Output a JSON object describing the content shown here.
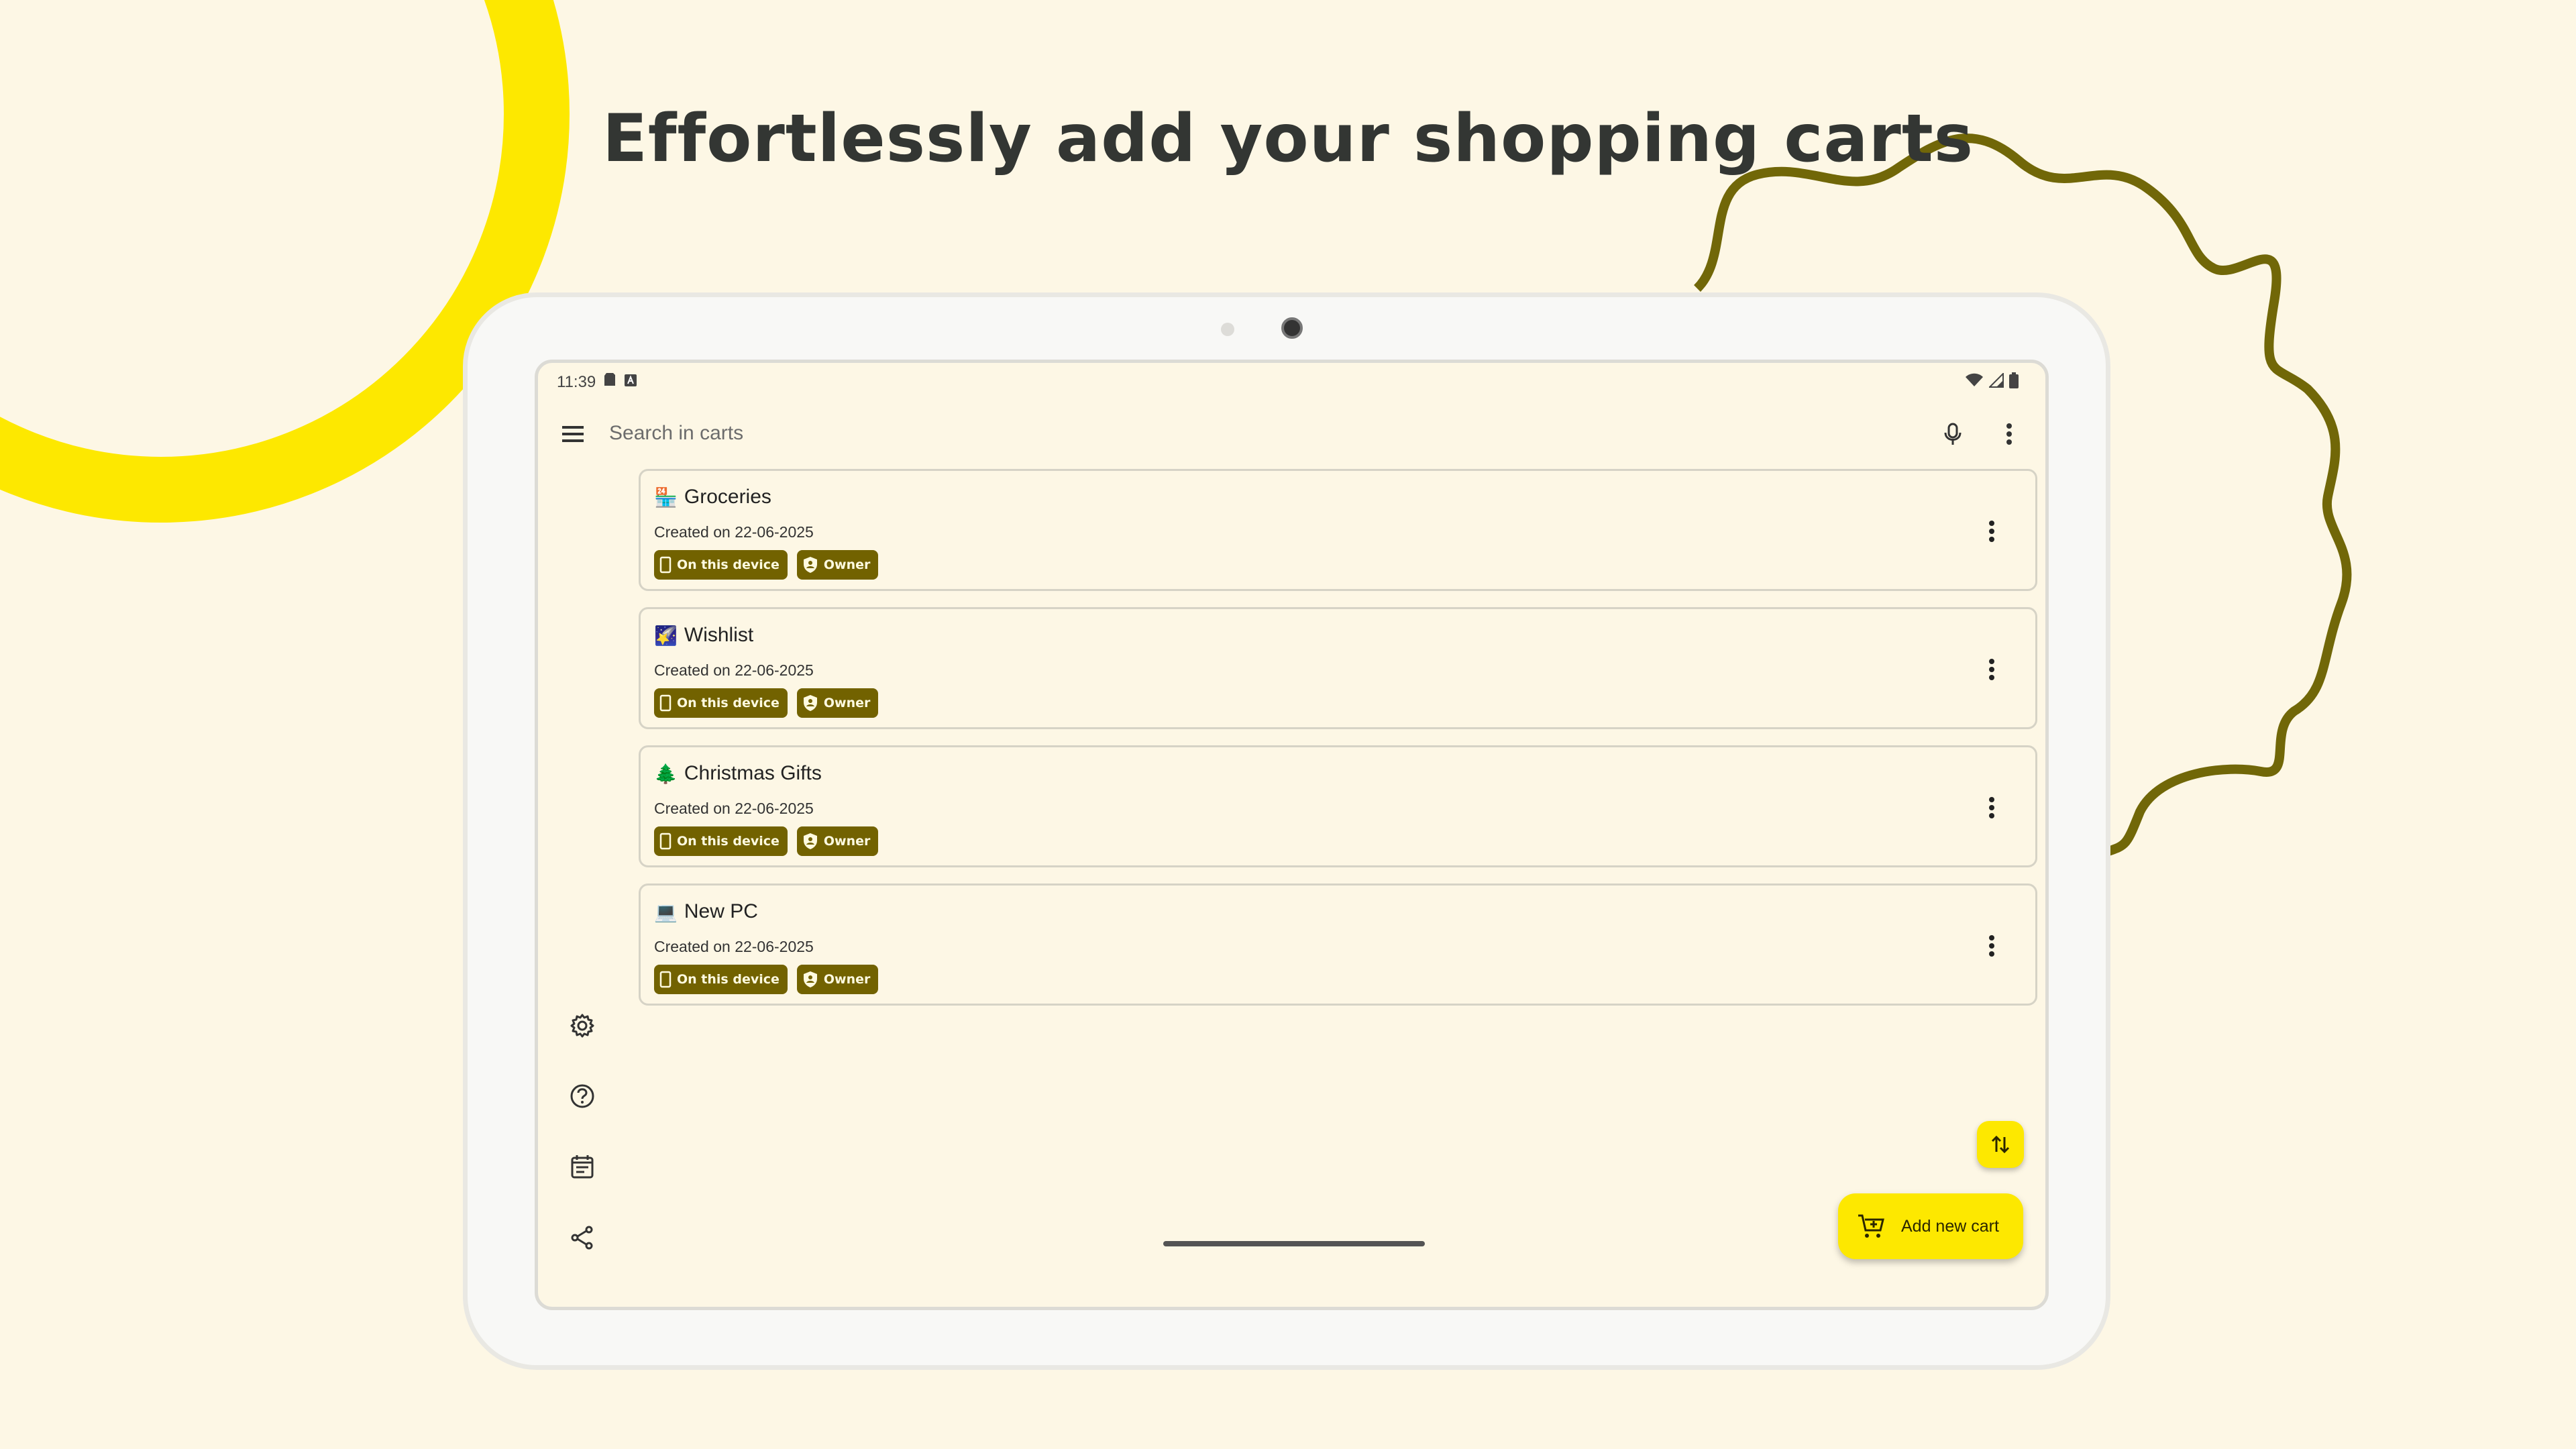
{
  "headline": "Effortlessly add your shopping carts",
  "colors": {
    "background": "#fdf7e5",
    "accent_yellow": "#fde800",
    "chip_olive": "#726200",
    "squiggle_olive": "#716708"
  },
  "status_bar": {
    "time": "11:39",
    "icons": [
      "sd-card-icon",
      "a-icon",
      "wifi-icon",
      "signal-icon",
      "battery-icon"
    ]
  },
  "search": {
    "placeholder": "Search in carts",
    "icons": [
      "menu-icon",
      "mic-icon",
      "more-vert-icon"
    ]
  },
  "carts": [
    {
      "emoji": "🏪",
      "name": "Groceries",
      "date": "Created on 22-06-2025",
      "chips": [
        "On this device",
        "Owner"
      ]
    },
    {
      "emoji": "🌠",
      "name": "Wishlist",
      "date": "Created on 22-06-2025",
      "chips": [
        "On this device",
        "Owner"
      ]
    },
    {
      "emoji": "🌲",
      "name": "Christmas Gifts",
      "date": "Created on 22-06-2025",
      "chips": [
        "On this device",
        "Owner"
      ]
    },
    {
      "emoji": "💻",
      "name": "New PC",
      "date": "Created on 22-06-2025",
      "chips": [
        "On this device",
        "Owner"
      ]
    }
  ],
  "nav_rail": [
    "settings-icon",
    "help-icon",
    "calendar-icon",
    "share-icon"
  ],
  "fab": {
    "sort_icon": "swap-vert-icon",
    "add_label": "Add new cart",
    "add_icon": "add-shopping-cart-icon"
  }
}
